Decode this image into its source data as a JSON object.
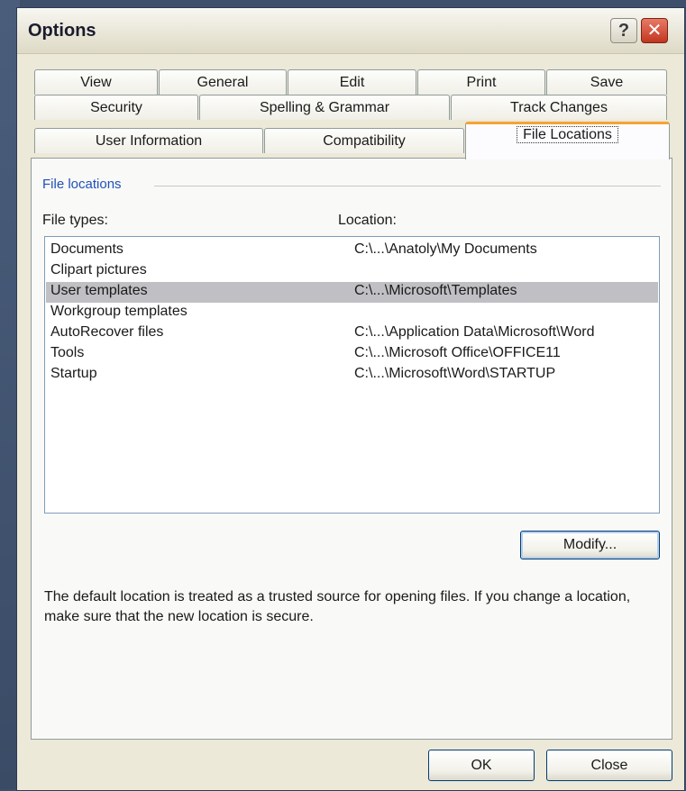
{
  "window": {
    "title": "Options",
    "help_glyph": "?",
    "close_glyph": "✕"
  },
  "tabs": {
    "row1": [
      "View",
      "General",
      "Edit",
      "Print",
      "Save"
    ],
    "row2": [
      "Security",
      "Spelling & Grammar",
      "Track Changes"
    ],
    "row3": [
      "User Information",
      "Compatibility",
      "File Locations"
    ],
    "active": "File Locations"
  },
  "group": {
    "label": "File locations"
  },
  "columns": {
    "file_types": "File types:",
    "location": "Location:"
  },
  "file_locations": [
    {
      "type": "Documents",
      "location": "C:\\...\\Anatoly\\My Documents"
    },
    {
      "type": "Clipart pictures",
      "location": ""
    },
    {
      "type": "User templates",
      "location": "C:\\...\\Microsoft\\Templates",
      "selected": true
    },
    {
      "type": "Workgroup templates",
      "location": ""
    },
    {
      "type": "AutoRecover files",
      "location": "C:\\...\\Application Data\\Microsoft\\Word"
    },
    {
      "type": "Tools",
      "location": "C:\\...\\Microsoft Office\\OFFICE11"
    },
    {
      "type": "Startup",
      "location": "C:\\...\\Microsoft\\Word\\STARTUP"
    }
  ],
  "buttons": {
    "modify": "Modify...",
    "ok": "OK",
    "close": "Close"
  },
  "description": "The default location is treated as a trusted source for opening files. If you change a location, make sure that the new location is secure.",
  "colors": {
    "accent_tab": "#f5a236",
    "group_label": "#2051b8",
    "selection": "#c0c0c4"
  }
}
